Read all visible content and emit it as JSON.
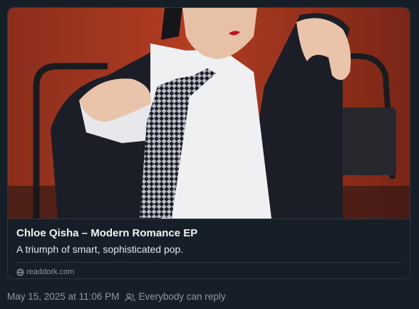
{
  "link_card": {
    "title": "Chloe Qisha – Modern Romance EP",
    "description": "A triumph of smart, sophisticated pop.",
    "domain": "readdork.com",
    "domain_icon": "globe-icon"
  },
  "post_meta": {
    "timestamp": "May 15, 2025 at 11:06 PM",
    "reply_setting": "Everybody can reply",
    "reply_icon": "people-icon"
  },
  "colors": {
    "background": "#161e27",
    "border": "#2c3743",
    "title_text": "#f1f3f5",
    "muted_text": "#8d99a6"
  }
}
